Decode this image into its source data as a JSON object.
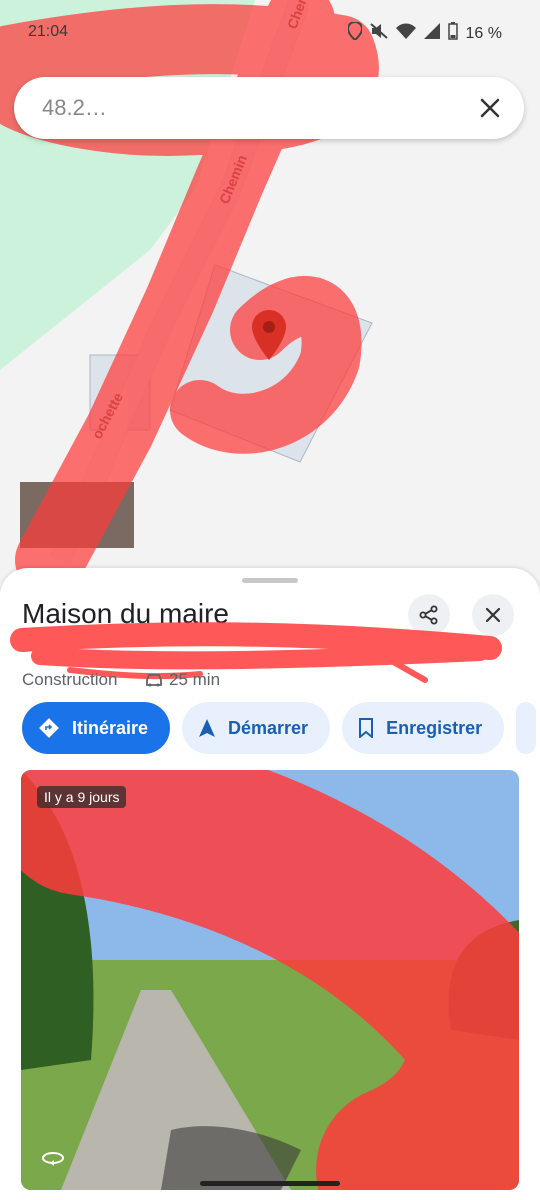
{
  "status_bar": {
    "time": "21:04",
    "battery_text": "16 %",
    "icons": [
      "location-icon",
      "mute-icon",
      "wifi-icon",
      "signal-icon",
      "battery-icon"
    ]
  },
  "search": {
    "value": "48.2…",
    "close_icon": "close-icon"
  },
  "map": {
    "road_labels": [
      "Chem",
      "Chemin",
      "ochette"
    ],
    "pin_color": "#d93025"
  },
  "place": {
    "title": "Maison du maire",
    "category": "Construction",
    "travel_time": "25 min",
    "travel_mode_icon": "car-icon"
  },
  "actions": {
    "share_icon": "share-icon",
    "close_icon": "close-icon",
    "chips": [
      {
        "label": "Itinéraire",
        "icon": "directions-icon"
      },
      {
        "label": "Démarrer",
        "icon": "navigate-icon"
      },
      {
        "label": "Enregistrer",
        "icon": "bookmark-icon"
      }
    ]
  },
  "photo": {
    "badge": "Il y a 9 jours",
    "icon": "360-icon"
  },
  "colors": {
    "accent": "#1a73e8",
    "chip_bg": "#e8f0fe",
    "redaction": "#ff3b3b"
  }
}
